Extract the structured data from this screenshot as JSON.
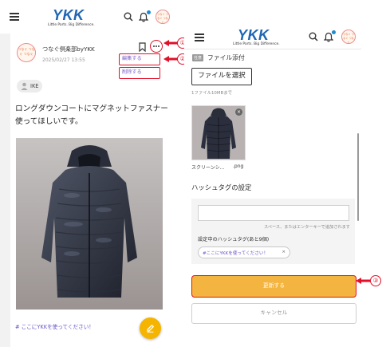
{
  "colors": {
    "accent_red": "#e0102a",
    "brand_blue": "#1f66b3",
    "update_orange": "#f4b440",
    "fab_yellow": "#f4b400",
    "link_purple": "#6a55c6"
  },
  "header": {
    "logo_word": "YKK",
    "logo_tagline": "Little Parts. Big Difference.",
    "avatar_text": "つなぐ つなぐ つなぐ"
  },
  "post": {
    "author": "つなぐ倶楽部byYKK",
    "date": "2025/02/27 13:55",
    "menu": {
      "edit_label": "編集する",
      "delete_label": "削除する"
    },
    "tag_user": "IKE",
    "body_line1": "ロングダウンコートにマグネットファスナー",
    "body_line2": "使ってほしいです。",
    "hashtag": "# ここにYKKを使ってください！",
    "image_icon": "jacket-photo"
  },
  "callouts": {
    "c1": "①",
    "c2": "②",
    "c3": "③"
  },
  "edit_form": {
    "attach": {
      "required_badge": "任意",
      "label": "ファイル添付",
      "button": "ファイルを選択",
      "note": "1ファイル10MBまで"
    },
    "thumbnail": {
      "name": "スクリーンシ...",
      "ext": ".png",
      "remove_symbol": "×"
    },
    "hashtag": {
      "title": "ハッシュタグの設定",
      "input_value": "",
      "help": "スペース、またはエンターキーで追加されます",
      "count_label": "設定中のハッシュタグ(あと9個)",
      "chip": "#ここにYKKを使ってください！",
      "chip_remove": "×"
    },
    "update_button": "更新する",
    "cancel_button": "キャンセル"
  }
}
